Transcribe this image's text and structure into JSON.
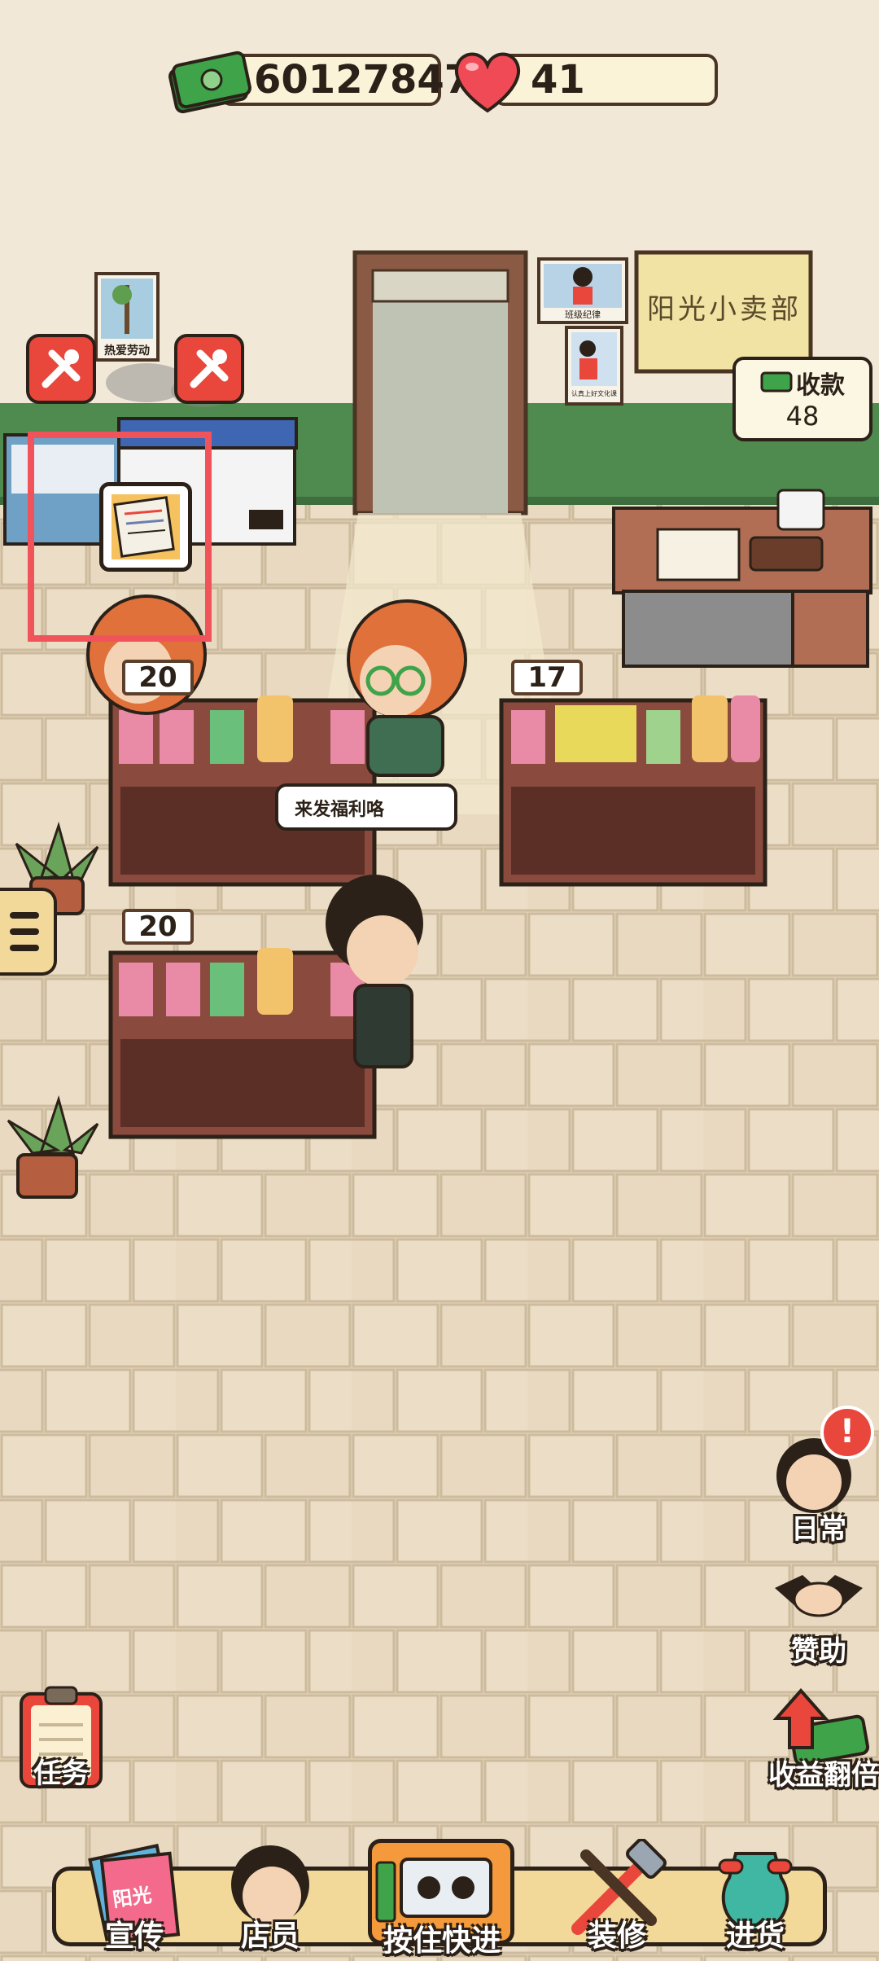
{
  "hud": {
    "money": "601278478",
    "hearts": "41"
  },
  "shop": {
    "sign": "阳光小卖部",
    "poster_labor": "热爱劳动",
    "poster_class": "班级纪律",
    "poster_study": "认真上好文化课"
  },
  "checkout": {
    "title": "收款",
    "amount": "48"
  },
  "shelves": [
    {
      "stock": "20"
    },
    {
      "stock": "17"
    },
    {
      "stock": "20"
    }
  ],
  "speech": {
    "customer_line": "来发福利咯"
  },
  "side_buttons": {
    "daily": "日常",
    "sponsor": "赞助",
    "double_income": "收益翻倍",
    "tasks": "任务",
    "alert": "!"
  },
  "nav": {
    "promote": "宣传",
    "promote_book": "阳光",
    "staff": "店员",
    "fast_forward": "按住快进",
    "decorate": "装修",
    "restock": "进货"
  },
  "colors": {
    "highlight": "#f0545a",
    "repair_badge": "#e9473c",
    "money_green": "#3fa34a",
    "heart_red": "#ef4a55",
    "wall_green": "#4f8a4f"
  }
}
